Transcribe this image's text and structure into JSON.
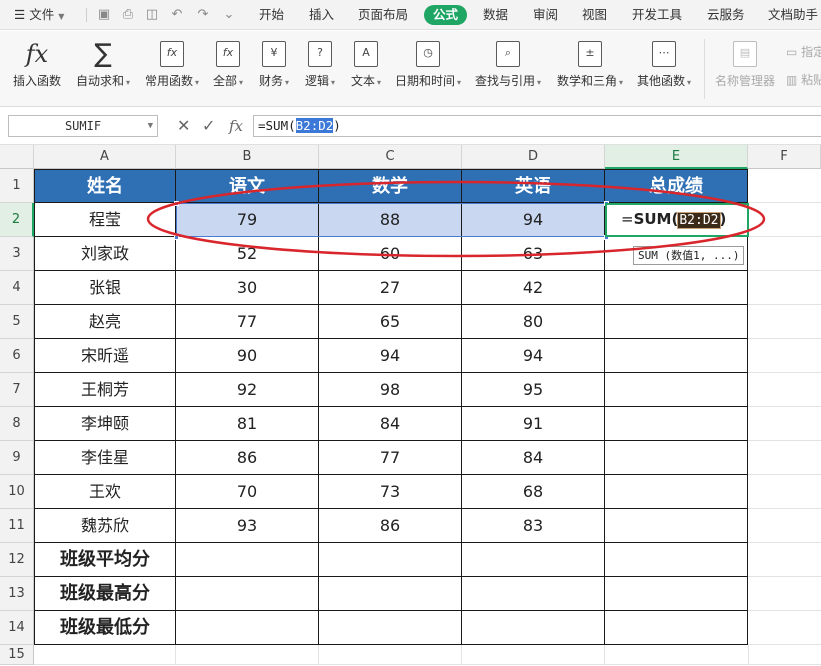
{
  "menubar": {
    "file_label": "文件",
    "tabs": [
      "开始",
      "插入",
      "页面布局",
      "公式",
      "数据",
      "审阅",
      "视图",
      "开发工具",
      "云服务",
      "文档助手"
    ],
    "active_tab": "公式",
    "active_color": "#1fa564"
  },
  "ribbon": {
    "buttons": [
      {
        "label": "插入函数",
        "icon": "fx-icon"
      },
      {
        "label": "自动求和",
        "icon": "sigma-icon"
      },
      {
        "label": "常用函数",
        "icon": "fx-star-icon"
      },
      {
        "label": "全部",
        "icon": "fx-doc-icon"
      },
      {
        "label": "财务",
        "icon": "yen-icon"
      },
      {
        "label": "逻辑",
        "icon": "question-icon"
      },
      {
        "label": "文本",
        "icon": "letter-a-icon"
      },
      {
        "label": "日期和时间",
        "icon": "clock-icon"
      },
      {
        "label": "查找与引用",
        "icon": "magnifier-icon"
      },
      {
        "label": "数学和三角",
        "icon": "plus-minus-icon"
      },
      {
        "label": "其他函数",
        "icon": "more-functions-icon"
      },
      {
        "label": "名称管理器",
        "icon": "name-manager-icon"
      }
    ],
    "side_items": [
      "指定",
      "粘贴"
    ]
  },
  "formula_bar": {
    "name_box": "SUMIF",
    "cancel_glyph": "✕",
    "enter_glyph": "✓",
    "fx_glyph": "fx",
    "formula_prefix": "=SUM(",
    "formula_ref": "B2:D2",
    "formula_suffix": ")"
  },
  "grid": {
    "columns": [
      "A",
      "B",
      "C",
      "D",
      "E",
      "F"
    ],
    "rows": [
      "1",
      "2",
      "3",
      "4",
      "5",
      "6",
      "7",
      "8",
      "9",
      "10",
      "11",
      "12",
      "13",
      "14",
      "15"
    ],
    "header_row": [
      "姓名",
      "语文",
      "数学",
      "英语",
      "总成绩"
    ],
    "header_color": "#2f6fb3",
    "data_rows": [
      {
        "name": "程莹",
        "chinese": "79",
        "math": "88",
        "english": "94"
      },
      {
        "name": "刘家政",
        "chinese": "52",
        "math": "60",
        "english": "63"
      },
      {
        "name": "张银",
        "chinese": "30",
        "math": "27",
        "english": "42"
      },
      {
        "name": "赵亮",
        "chinese": "77",
        "math": "65",
        "english": "80"
      },
      {
        "name": "宋昕遥",
        "chinese": "90",
        "math": "94",
        "english": "94"
      },
      {
        "name": "王桐芳",
        "chinese": "92",
        "math": "98",
        "english": "95"
      },
      {
        "name": "李坤颐",
        "chinese": "81",
        "math": "84",
        "english": "91"
      },
      {
        "name": "李佳星",
        "chinese": "86",
        "math": "77",
        "english": "84"
      },
      {
        "name": "王欢",
        "chinese": "70",
        "math": "73",
        "english": "68"
      },
      {
        "name": "魏苏欣",
        "chinese": "93",
        "math": "86",
        "english": "83"
      }
    ],
    "summary_rows": [
      "班级平均分",
      "班级最高分",
      "班级最低分"
    ],
    "edit_cell": {
      "prefix": "=",
      "func": "SUM",
      "open": "(",
      "ref": "B2:D2",
      "close": ")"
    },
    "tooltip": "SUM (数值1, ...)",
    "annotation_color": "#d9262c"
  }
}
